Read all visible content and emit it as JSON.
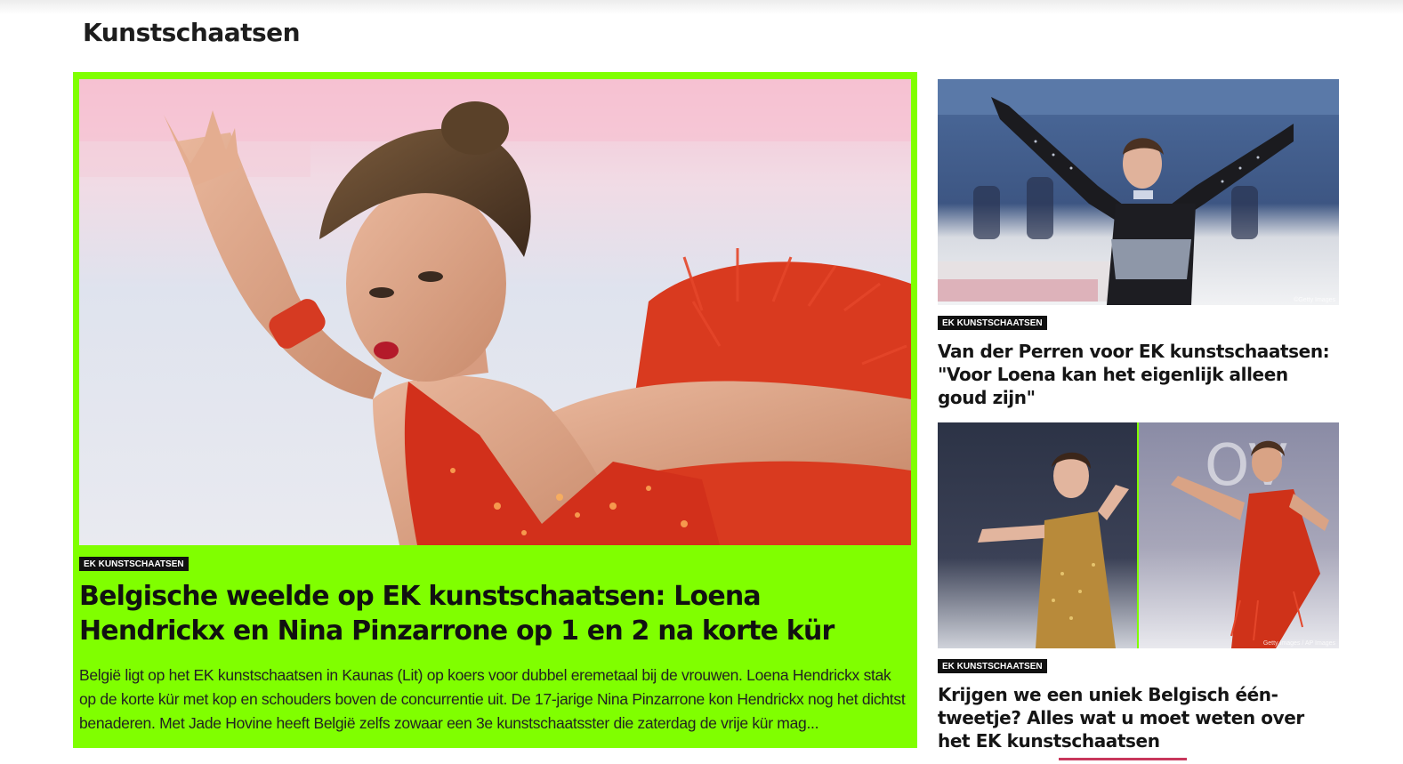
{
  "section": {
    "title": "Kunstschaatsen"
  },
  "featured": {
    "category": "EK KUNSTSCHAATSEN",
    "headline": "Belgische weelde op EK kunstschaatsen: Loena Hendrickx en Nina Pinzarrone op 1 en 2 na korte kür",
    "summary": "België ligt op het EK kunstschaatsen in Kaunas (Lit) op koers voor dubbel eremetaal bij de vrouwen. Loena Hendrickx stak op de korte kür met kop en schouders boven de concurrentie uit. De 17-jarige Nina Pinzarrone kon Hendrickx nog het dichtst benaderen. Met Jade Hovine heeft België zelfs zowaar een 3e kunstschaatsster die zaterdag de vrije kür mag..."
  },
  "side_articles": [
    {
      "category": "EK KUNSTSCHAATSEN",
      "headline": "Van der Perren voor EK kunstschaatsen: \"Voor Loena kan het eigenlijk alleen goud zijn\"",
      "image_credit": "©Getty Images"
    },
    {
      "category": "EK KUNSTSCHAATSEN",
      "headline": "Krijgen we een uniek Belgisch één-tweetje? Alles wat u moet weten over het EK kunstschaatsen",
      "image_credit": "Getty Images / AP Images"
    }
  ],
  "colors": {
    "accent": "#80ff00",
    "badge_bg": "#111111",
    "text": "#111111"
  }
}
